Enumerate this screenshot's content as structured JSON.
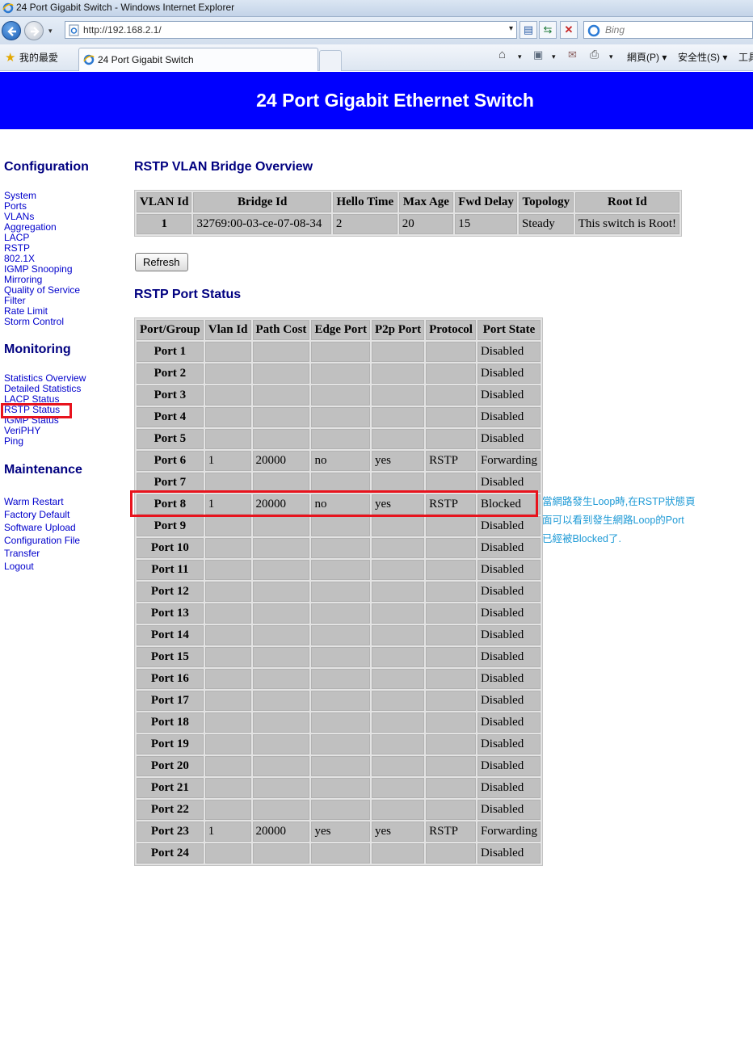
{
  "window": {
    "title": "24 Port Gigabit Switch - Windows Internet Explorer"
  },
  "browser": {
    "url": "http://192.168.2.1/",
    "search_placeholder": "Bing",
    "favorites_label": "我的最愛",
    "tab_label": "24 Port Gigabit Switch",
    "commands": {
      "page": "網頁(P)",
      "safety": "安全性(S)",
      "tools": "工具"
    },
    "dropdown_glyph": "▾"
  },
  "page": {
    "banner_title": "24 Port Gigabit Ethernet Switch",
    "sidebar": {
      "configuration": {
        "title": "Configuration",
        "links": [
          "System",
          "Ports",
          "VLANs",
          "Aggregation",
          "LACP",
          "RSTP",
          "802.1X",
          "IGMP Snooping",
          "Mirroring",
          "Quality of Service",
          "Filter",
          "Rate Limit",
          "Storm Control"
        ]
      },
      "monitoring": {
        "title": "Monitoring",
        "links": [
          "Statistics Overview",
          "Detailed Statistics",
          "LACP Status",
          "RSTP Status",
          "IGMP Status",
          "VeriPHY",
          "Ping"
        ]
      },
      "maintenance": {
        "title": "Maintenance",
        "links": [
          "Warm Restart",
          "Factory Default",
          "Software Upload",
          "Configuration File Transfer",
          "Logout"
        ]
      }
    },
    "bridge_overview": {
      "title": "RSTP VLAN Bridge Overview",
      "columns": [
        "VLAN Id",
        "Bridge Id",
        "Hello Time",
        "Max Age",
        "Fwd Delay",
        "Topology",
        "Root Id"
      ],
      "row": {
        "vlan_id": "1",
        "bridge_id": "32769:00-03-ce-07-08-34",
        "hello_time": "2",
        "max_age": "20",
        "fwd_delay": "15",
        "topology": "Steady",
        "root_id": "This switch is Root!"
      }
    },
    "refresh_label": "Refresh",
    "port_status": {
      "title": "RSTP Port Status",
      "columns": [
        "Port/Group",
        "Vlan Id",
        "Path Cost",
        "Edge Port",
        "P2p Port",
        "Protocol",
        "Port State"
      ],
      "rows": [
        {
          "port": "Port 1",
          "vlan": "",
          "cost": "",
          "edge": "",
          "p2p": "",
          "protocol": "",
          "state": "Disabled"
        },
        {
          "port": "Port 2",
          "vlan": "",
          "cost": "",
          "edge": "",
          "p2p": "",
          "protocol": "",
          "state": "Disabled"
        },
        {
          "port": "Port 3",
          "vlan": "",
          "cost": "",
          "edge": "",
          "p2p": "",
          "protocol": "",
          "state": "Disabled"
        },
        {
          "port": "Port 4",
          "vlan": "",
          "cost": "",
          "edge": "",
          "p2p": "",
          "protocol": "",
          "state": "Disabled"
        },
        {
          "port": "Port 5",
          "vlan": "",
          "cost": "",
          "edge": "",
          "p2p": "",
          "protocol": "",
          "state": "Disabled"
        },
        {
          "port": "Port 6",
          "vlan": "1",
          "cost": "20000",
          "edge": "no",
          "p2p": "yes",
          "protocol": "RSTP",
          "state": "Forwarding"
        },
        {
          "port": "Port 7",
          "vlan": "",
          "cost": "",
          "edge": "",
          "p2p": "",
          "protocol": "",
          "state": "Disabled"
        },
        {
          "port": "Port 8",
          "vlan": "1",
          "cost": "20000",
          "edge": "no",
          "p2p": "yes",
          "protocol": "RSTP",
          "state": "Blocked"
        },
        {
          "port": "Port 9",
          "vlan": "",
          "cost": "",
          "edge": "",
          "p2p": "",
          "protocol": "",
          "state": "Disabled"
        },
        {
          "port": "Port 10",
          "vlan": "",
          "cost": "",
          "edge": "",
          "p2p": "",
          "protocol": "",
          "state": "Disabled"
        },
        {
          "port": "Port 11",
          "vlan": "",
          "cost": "",
          "edge": "",
          "p2p": "",
          "protocol": "",
          "state": "Disabled"
        },
        {
          "port": "Port 12",
          "vlan": "",
          "cost": "",
          "edge": "",
          "p2p": "",
          "protocol": "",
          "state": "Disabled"
        },
        {
          "port": "Port 13",
          "vlan": "",
          "cost": "",
          "edge": "",
          "p2p": "",
          "protocol": "",
          "state": "Disabled"
        },
        {
          "port": "Port 14",
          "vlan": "",
          "cost": "",
          "edge": "",
          "p2p": "",
          "protocol": "",
          "state": "Disabled"
        },
        {
          "port": "Port 15",
          "vlan": "",
          "cost": "",
          "edge": "",
          "p2p": "",
          "protocol": "",
          "state": "Disabled"
        },
        {
          "port": "Port 16",
          "vlan": "",
          "cost": "",
          "edge": "",
          "p2p": "",
          "protocol": "",
          "state": "Disabled"
        },
        {
          "port": "Port 17",
          "vlan": "",
          "cost": "",
          "edge": "",
          "p2p": "",
          "protocol": "",
          "state": "Disabled"
        },
        {
          "port": "Port 18",
          "vlan": "",
          "cost": "",
          "edge": "",
          "p2p": "",
          "protocol": "",
          "state": "Disabled"
        },
        {
          "port": "Port 19",
          "vlan": "",
          "cost": "",
          "edge": "",
          "p2p": "",
          "protocol": "",
          "state": "Disabled"
        },
        {
          "port": "Port 20",
          "vlan": "",
          "cost": "",
          "edge": "",
          "p2p": "",
          "protocol": "",
          "state": "Disabled"
        },
        {
          "port": "Port 21",
          "vlan": "",
          "cost": "",
          "edge": "",
          "p2p": "",
          "protocol": "",
          "state": "Disabled"
        },
        {
          "port": "Port 22",
          "vlan": "",
          "cost": "",
          "edge": "",
          "p2p": "",
          "protocol": "",
          "state": "Disabled"
        },
        {
          "port": "Port 23",
          "vlan": "1",
          "cost": "20000",
          "edge": "yes",
          "p2p": "yes",
          "protocol": "RSTP",
          "state": "Forwarding"
        },
        {
          "port": "Port 24",
          "vlan": "",
          "cost": "",
          "edge": "",
          "p2p": "",
          "protocol": "",
          "state": "Disabled"
        }
      ]
    },
    "annotation": {
      "lines": [
        "當網路發生Loop時,在RSTP狀態頁",
        "面可以看到發生網路Loop的Port",
        "已經被Blocked了."
      ],
      "color": "#1e9ad6"
    },
    "colors": {
      "banner": "#0000ff",
      "highlight": "#e8131d",
      "cell": "#c0c0c0",
      "heading": "#000080",
      "link": "#0000cc"
    }
  }
}
